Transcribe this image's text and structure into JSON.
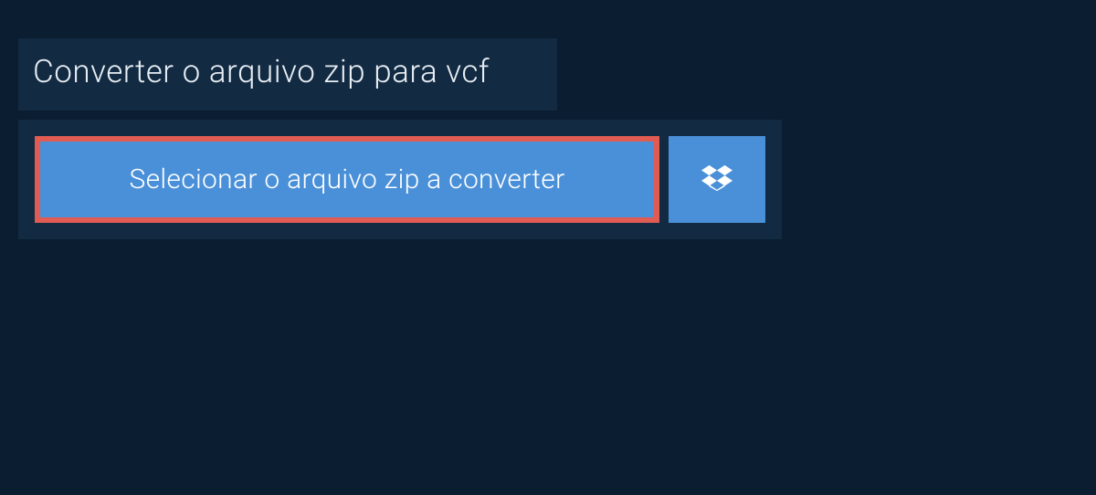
{
  "header": {
    "title": "Converter o arquivo zip para vcf"
  },
  "action": {
    "select_file_label": "Selecionar o arquivo zip a converter"
  },
  "colors": {
    "background": "#0b1d30",
    "panel": "#122a42",
    "button_bg": "#4a90d9",
    "highlight_border": "#e05b52",
    "text_light": "#e8eef4",
    "text_white": "#ffffff"
  },
  "icons": {
    "dropbox": "dropbox-icon"
  }
}
